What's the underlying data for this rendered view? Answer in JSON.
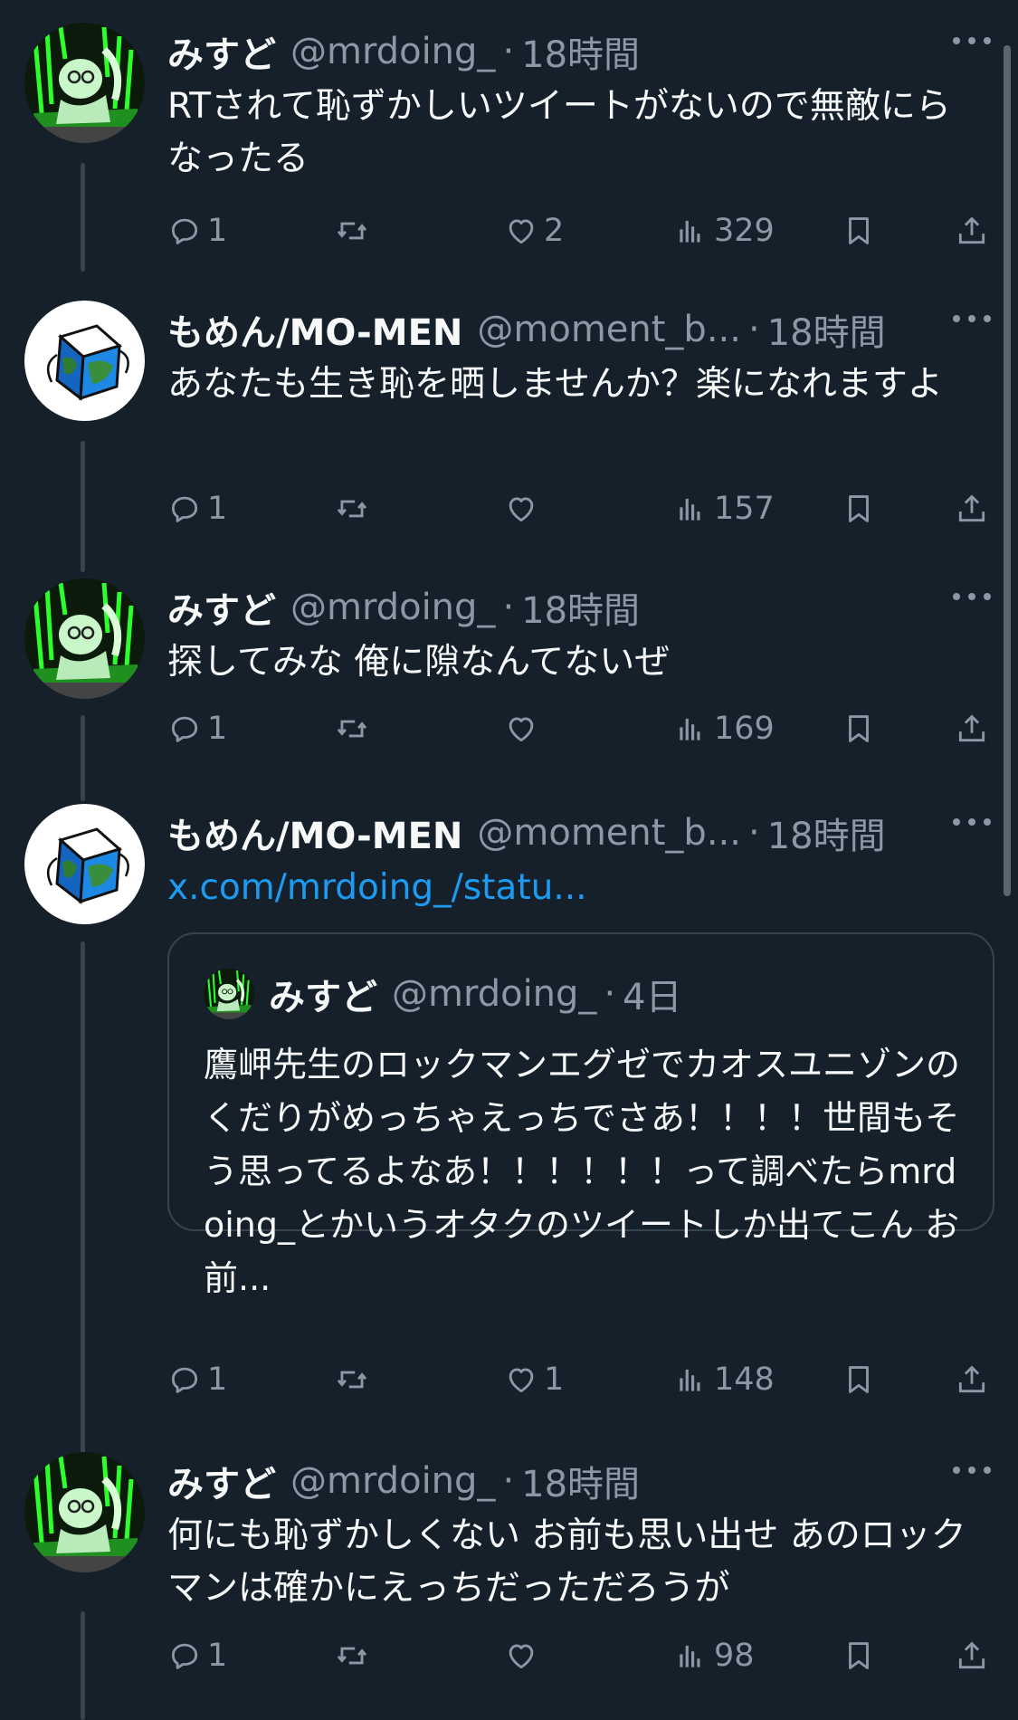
{
  "tweets": [
    {
      "author": "みすど",
      "handle": "@mrdoing_",
      "time": "18時間",
      "text": "RTされて恥ずかしいツイートがないので無敵にらなったる",
      "replies": "1",
      "retweets": "",
      "likes": "2",
      "views": "329"
    },
    {
      "author": "もめん/MO-MEN",
      "handle": "@moment_b...",
      "time": "18時間",
      "text": "あなたも生き恥を晒しませんか？楽になれますよ",
      "replies": "1",
      "retweets": "",
      "likes": "",
      "views": "157"
    },
    {
      "author": "みすど",
      "handle": "@mrdoing_",
      "time": "18時間",
      "text": "探してみな 俺に隙なんてないぜ",
      "replies": "1",
      "retweets": "",
      "likes": "",
      "views": "169"
    },
    {
      "author": "もめん/MO-MEN",
      "handle": "@moment_b...",
      "time": "18時間",
      "link": "x.com/mrdoing_/statu...",
      "quote": {
        "author": "みすど",
        "handle": "@mrdoing_",
        "time": "4日",
        "text": "鷹岬先生のロックマンエグゼでカオスユニゾンのくだりがめっちゃえっちでさあ！！！！世間もそう思ってるよなあ！！！！！！って調べたらmrdoing_とかいうオタクのツイートしか出てこん お前..."
      },
      "replies": "1",
      "retweets": "",
      "likes": "1",
      "views": "148"
    },
    {
      "author": "みすど",
      "handle": "@mrdoing_",
      "time": "18時間",
      "text": "何にも恥ずかしくない お前も思い出せ あのロックマンは確かにえっちだっただろうが",
      "replies": "1",
      "retweets": "",
      "likes": "",
      "views": "98"
    }
  ],
  "colors": {
    "background": "#15202b",
    "secondary_text": "#8b98a5",
    "link": "#1d9bf0",
    "border": "#38444d"
  },
  "icons": [
    "more-icon",
    "reply-icon",
    "retweet-icon",
    "like-icon",
    "views-icon",
    "bookmark-icon",
    "share-icon"
  ]
}
